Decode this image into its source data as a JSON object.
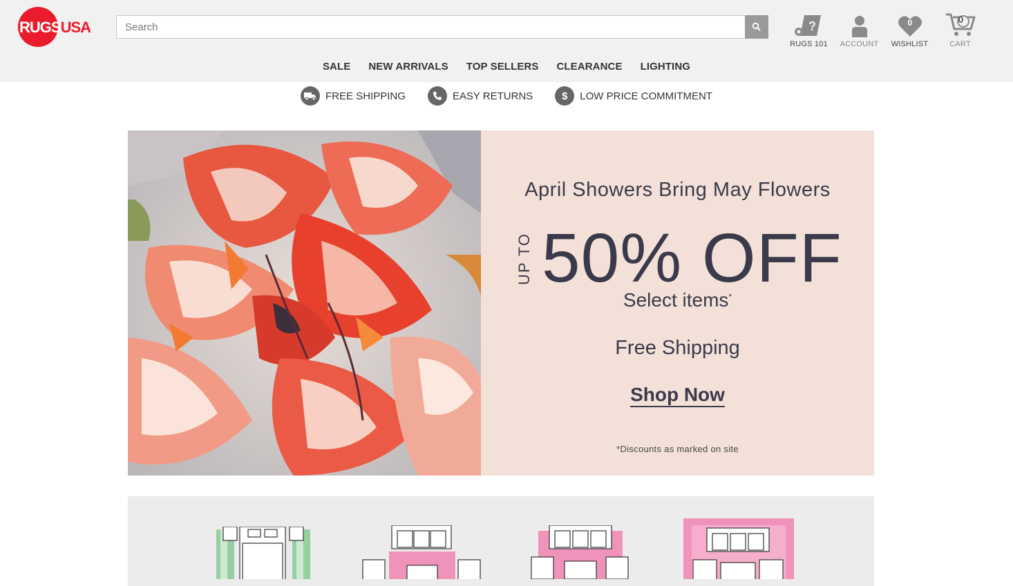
{
  "logo": {
    "part1": "RUGS",
    "part2": "USA"
  },
  "search": {
    "placeholder": "Search"
  },
  "header_icons": [
    {
      "label": "RUGS 101",
      "icon": "rugs101-icon"
    },
    {
      "label": "ACCOUNT",
      "icon": "user-icon"
    },
    {
      "label": "WISHLIST",
      "icon": "heart-icon",
      "count": "0"
    },
    {
      "label": "CART",
      "icon": "cart-icon",
      "count": "0"
    }
  ],
  "nav": [
    "SALE",
    "NEW ARRIVALS",
    "TOP SELLERS",
    "CLEARANCE",
    "LIGHTING"
  ],
  "perks": [
    {
      "label": "FREE SHIPPING",
      "icon": "truck-icon"
    },
    {
      "label": "EASY RETURNS",
      "icon": "phone-icon"
    },
    {
      "label": "LOW PRICE COMMITMENT",
      "icon": "dollar-icon",
      "glyph": "$"
    }
  ],
  "hero": {
    "title": "April Showers Bring May Flowers",
    "upto": "UP TO",
    "headline": "50% OFF",
    "select": "Select items",
    "asterisk": "*",
    "free": "Free Shipping",
    "cta": "Shop Now",
    "disclaimer": "*Discounts as marked on site"
  },
  "colors": {
    "brand_red": "#ea1c2b",
    "hero_panel": "#f3e1d9",
    "hero_text": "#3a3a4a",
    "rug_green": "#96cfa0",
    "rug_pink": "#f093ba"
  }
}
